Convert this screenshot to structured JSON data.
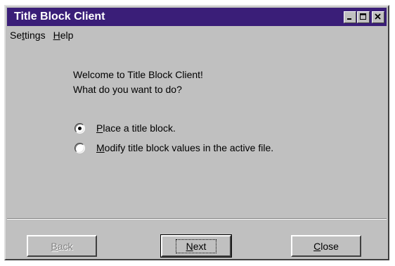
{
  "window": {
    "title": "Title Block Client",
    "title_bar_color": "#3a1e78",
    "controls": [
      "minimize-icon",
      "maximize-icon",
      "close-icon"
    ]
  },
  "menubar": {
    "items": [
      {
        "label_prefix": "Se",
        "label_mnemonic": "t",
        "label_suffix": "tings"
      },
      {
        "label_prefix": "",
        "label_mnemonic": "H",
        "label_suffix": "elp"
      }
    ]
  },
  "main": {
    "welcome_line1": "Welcome to Title Block Client!",
    "welcome_line2": "What do you want to do?",
    "options": [
      {
        "mnemonic": "P",
        "rest": "lace a title block.",
        "checked": true
      },
      {
        "mnemonic": "M",
        "rest": "odify title block values in the active file.",
        "checked": false
      }
    ]
  },
  "footer": {
    "back": {
      "mnemonic": "B",
      "rest": "ack",
      "disabled": true
    },
    "next": {
      "mnemonic": "N",
      "rest": "ext",
      "default": true
    },
    "close": {
      "mnemonic": "C",
      "rest": "lose"
    }
  }
}
